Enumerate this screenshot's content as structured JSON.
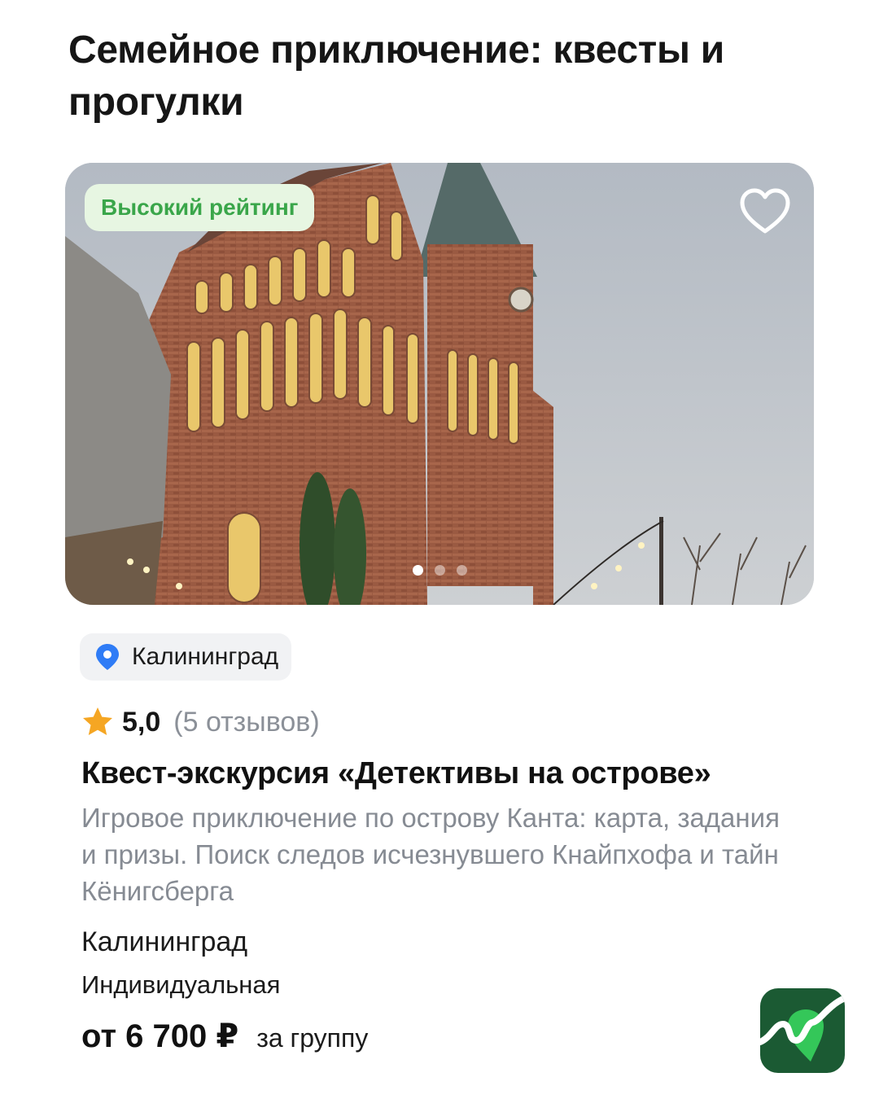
{
  "header": {
    "title": "Семейное приключение: квесты и прогулки"
  },
  "card": {
    "badge": "Высокий рейтинг",
    "favorite_icon": "heart-outline-icon",
    "carousel": {
      "total": 3,
      "active": 1
    },
    "location_chip": "Калининград",
    "location_icon": "map-pin-icon",
    "rating": {
      "value": "5,0",
      "reviews": "(5 отзывов)",
      "icon": "star-icon",
      "star_color": "#f5a623"
    },
    "title": "Квест-экскурсия «Детективы на острове»",
    "description": "Игровое приключение по острову Канта: карта, задания и призы. Поиск следов исчезнувшего Кнайпхофа и тайн Кёнигсберга",
    "city": "Калининград",
    "format": "Индивидуальная",
    "price": "от 6 700 ₽",
    "price_unit": "за группу"
  },
  "colors": {
    "badge_text": "#3aa64a",
    "badge_bg": "#e7f6e2",
    "pin": "#2f7cf6",
    "logo_bg": "#1b5a33",
    "logo_accent": "#34c759"
  },
  "app_logo_icon": "app-logo-icon"
}
